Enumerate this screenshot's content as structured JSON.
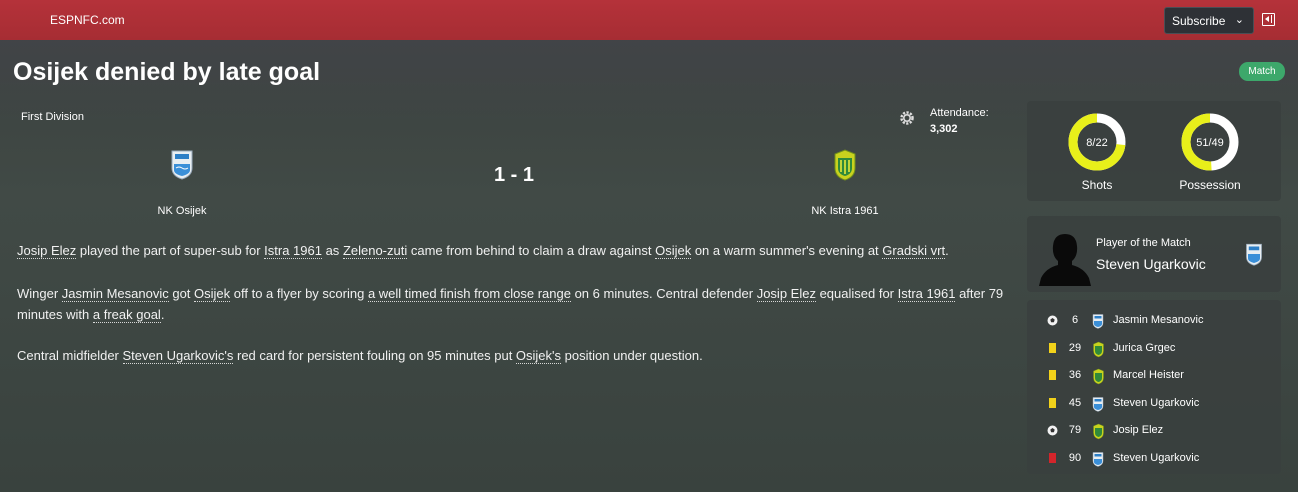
{
  "header": {
    "site_name": "ESPNFC.com",
    "subscribe_label": "Subscribe"
  },
  "article": {
    "headline": "Osijek denied by late goal",
    "badge": "Match"
  },
  "match": {
    "competition": "First Division",
    "attendance_label": "Attendance:",
    "attendance_value": "3,302",
    "score": "1 - 1",
    "home_team": "NK Osijek",
    "away_team": "NK Istra 1961"
  },
  "report": {
    "p1": [
      {
        "t": "Josip Elez",
        "link": true
      },
      {
        "t": " played the part of super-sub for ",
        "link": false
      },
      {
        "t": "Istra 1961",
        "link": true
      },
      {
        "t": " as ",
        "link": false
      },
      {
        "t": "Zeleno-zuti",
        "link": true
      },
      {
        "t": " came from behind to claim a draw against ",
        "link": false
      },
      {
        "t": "Osijek",
        "link": true
      },
      {
        "t": " on a warm summer's evening at ",
        "link": false
      },
      {
        "t": "Gradski vrt",
        "link": true
      },
      {
        "t": ".",
        "link": false
      }
    ],
    "p2": [
      {
        "t": "Winger ",
        "link": false
      },
      {
        "t": "Jasmin Mesanovic",
        "link": true
      },
      {
        "t": " got ",
        "link": false
      },
      {
        "t": "Osijek",
        "link": true
      },
      {
        "t": " off to a flyer by scoring ",
        "link": false
      },
      {
        "t": "a well timed finish from close range",
        "link": true
      },
      {
        "t": " on 6 minutes. Central defender ",
        "link": false
      },
      {
        "t": "Josip Elez",
        "link": true
      },
      {
        "t": " equalised for ",
        "link": false
      },
      {
        "t": "Istra 1961",
        "link": true
      },
      {
        "t": " after 79 minutes with ",
        "link": false
      },
      {
        "t": "a freak goal",
        "link": true
      },
      {
        "t": ".",
        "link": false
      }
    ],
    "p3": [
      {
        "t": "Central midfielder ",
        "link": false
      },
      {
        "t": "Steven Ugarkovic's",
        "link": true
      },
      {
        "t": " red card for persistent fouling on 95 minutes put ",
        "link": false
      },
      {
        "t": "Osijek's",
        "link": true
      },
      {
        "t": " position under question.",
        "link": false
      }
    ]
  },
  "stats": {
    "shots": {
      "text": "8/22",
      "label": "Shots",
      "fraction": 0.267
    },
    "possession": {
      "text": "51/49",
      "label": "Possession",
      "fraction": 0.49
    },
    "ring_color": "#e8ef1a"
  },
  "potm": {
    "title": "Player of the Match",
    "name": "Steven Ugarkovic"
  },
  "events": [
    {
      "type": "goal",
      "minute": "6",
      "team": "home",
      "player": "Jasmin Mesanovic"
    },
    {
      "type": "yellow",
      "minute": "29",
      "team": "away",
      "player": "Jurica Grgec"
    },
    {
      "type": "yellow",
      "minute": "36",
      "team": "away",
      "player": "Marcel Heister"
    },
    {
      "type": "yellow",
      "minute": "45",
      "team": "home",
      "player": "Steven Ugarkovic"
    },
    {
      "type": "goal",
      "minute": "79",
      "team": "away",
      "player": "Josip Elez"
    },
    {
      "type": "red",
      "minute": "90",
      "team": "home",
      "player": "Steven Ugarkovic"
    }
  ],
  "colors": {
    "topbar": "#b5323a",
    "badge": "#3da86b",
    "yellow_card": "#f2d21a",
    "red_card": "#d3252b"
  }
}
